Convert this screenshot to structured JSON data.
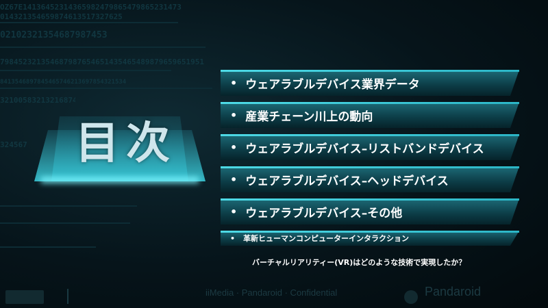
{
  "title": "目次",
  "items": [
    {
      "label": "ウェアラブルデバイス業界データ"
    },
    {
      "label": "産業チェーン川上の動向"
    },
    {
      "label": "ウェアラブルデバイス–リストバンドデバイス"
    },
    {
      "label": "ウェアラブルデバイス–ヘッドデバイス"
    },
    {
      "label": "ウェアラブルデバイス–その他"
    }
  ],
  "small_item": {
    "label": "革新ヒューマンコンピューターインタラクション"
  },
  "subline": "バーチャルリアリティー(VR)はどのような技術で実現したか？",
  "bullet": "•",
  "footer": {
    "confidential": "iiMedia · Pandaroid · Confidential",
    "brand": "Pandaroid"
  },
  "bg_digits": [
    "OZ67E14136452314365982479865479865231473",
    "014321354659874613517327625",
    "02102321354687987453",
    "798452321354687987654651435465489879659651951",
    "8413546897845465746213697854321534",
    "321005832132168746518",
    "324567"
  ]
}
